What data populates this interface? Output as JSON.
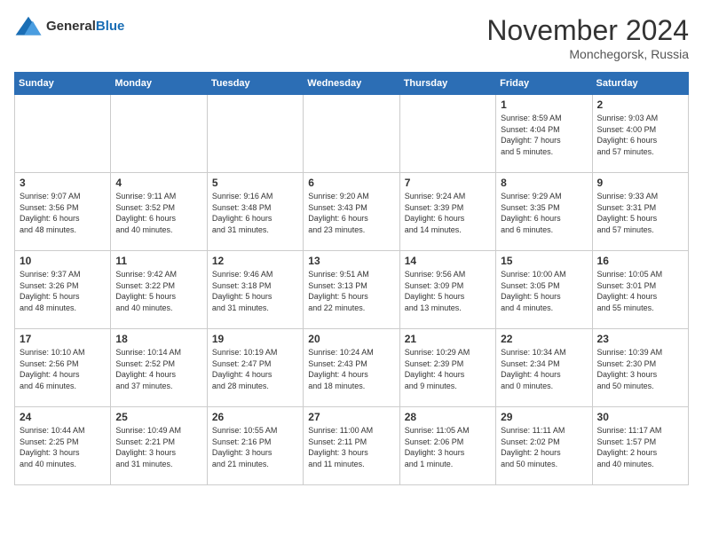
{
  "logo": {
    "general": "General",
    "blue": "Blue"
  },
  "title": "November 2024",
  "location": "Monchegorsk, Russia",
  "days_header": [
    "Sunday",
    "Monday",
    "Tuesday",
    "Wednesday",
    "Thursday",
    "Friday",
    "Saturday"
  ],
  "weeks": [
    [
      {
        "day": "",
        "info": ""
      },
      {
        "day": "",
        "info": ""
      },
      {
        "day": "",
        "info": ""
      },
      {
        "day": "",
        "info": ""
      },
      {
        "day": "",
        "info": ""
      },
      {
        "day": "1",
        "info": "Sunrise: 8:59 AM\nSunset: 4:04 PM\nDaylight: 7 hours\nand 5 minutes."
      },
      {
        "day": "2",
        "info": "Sunrise: 9:03 AM\nSunset: 4:00 PM\nDaylight: 6 hours\nand 57 minutes."
      }
    ],
    [
      {
        "day": "3",
        "info": "Sunrise: 9:07 AM\nSunset: 3:56 PM\nDaylight: 6 hours\nand 48 minutes."
      },
      {
        "day": "4",
        "info": "Sunrise: 9:11 AM\nSunset: 3:52 PM\nDaylight: 6 hours\nand 40 minutes."
      },
      {
        "day": "5",
        "info": "Sunrise: 9:16 AM\nSunset: 3:48 PM\nDaylight: 6 hours\nand 31 minutes."
      },
      {
        "day": "6",
        "info": "Sunrise: 9:20 AM\nSunset: 3:43 PM\nDaylight: 6 hours\nand 23 minutes."
      },
      {
        "day": "7",
        "info": "Sunrise: 9:24 AM\nSunset: 3:39 PM\nDaylight: 6 hours\nand 14 minutes."
      },
      {
        "day": "8",
        "info": "Sunrise: 9:29 AM\nSunset: 3:35 PM\nDaylight: 6 hours\nand 6 minutes."
      },
      {
        "day": "9",
        "info": "Sunrise: 9:33 AM\nSunset: 3:31 PM\nDaylight: 5 hours\nand 57 minutes."
      }
    ],
    [
      {
        "day": "10",
        "info": "Sunrise: 9:37 AM\nSunset: 3:26 PM\nDaylight: 5 hours\nand 48 minutes."
      },
      {
        "day": "11",
        "info": "Sunrise: 9:42 AM\nSunset: 3:22 PM\nDaylight: 5 hours\nand 40 minutes."
      },
      {
        "day": "12",
        "info": "Sunrise: 9:46 AM\nSunset: 3:18 PM\nDaylight: 5 hours\nand 31 minutes."
      },
      {
        "day": "13",
        "info": "Sunrise: 9:51 AM\nSunset: 3:13 PM\nDaylight: 5 hours\nand 22 minutes."
      },
      {
        "day": "14",
        "info": "Sunrise: 9:56 AM\nSunset: 3:09 PM\nDaylight: 5 hours\nand 13 minutes."
      },
      {
        "day": "15",
        "info": "Sunrise: 10:00 AM\nSunset: 3:05 PM\nDaylight: 5 hours\nand 4 minutes."
      },
      {
        "day": "16",
        "info": "Sunrise: 10:05 AM\nSunset: 3:01 PM\nDaylight: 4 hours\nand 55 minutes."
      }
    ],
    [
      {
        "day": "17",
        "info": "Sunrise: 10:10 AM\nSunset: 2:56 PM\nDaylight: 4 hours\nand 46 minutes."
      },
      {
        "day": "18",
        "info": "Sunrise: 10:14 AM\nSunset: 2:52 PM\nDaylight: 4 hours\nand 37 minutes."
      },
      {
        "day": "19",
        "info": "Sunrise: 10:19 AM\nSunset: 2:47 PM\nDaylight: 4 hours\nand 28 minutes."
      },
      {
        "day": "20",
        "info": "Sunrise: 10:24 AM\nSunset: 2:43 PM\nDaylight: 4 hours\nand 18 minutes."
      },
      {
        "day": "21",
        "info": "Sunrise: 10:29 AM\nSunset: 2:39 PM\nDaylight: 4 hours\nand 9 minutes."
      },
      {
        "day": "22",
        "info": "Sunrise: 10:34 AM\nSunset: 2:34 PM\nDaylight: 4 hours\nand 0 minutes."
      },
      {
        "day": "23",
        "info": "Sunrise: 10:39 AM\nSunset: 2:30 PM\nDaylight: 3 hours\nand 50 minutes."
      }
    ],
    [
      {
        "day": "24",
        "info": "Sunrise: 10:44 AM\nSunset: 2:25 PM\nDaylight: 3 hours\nand 40 minutes."
      },
      {
        "day": "25",
        "info": "Sunrise: 10:49 AM\nSunset: 2:21 PM\nDaylight: 3 hours\nand 31 minutes."
      },
      {
        "day": "26",
        "info": "Sunrise: 10:55 AM\nSunset: 2:16 PM\nDaylight: 3 hours\nand 21 minutes."
      },
      {
        "day": "27",
        "info": "Sunrise: 11:00 AM\nSunset: 2:11 PM\nDaylight: 3 hours\nand 11 minutes."
      },
      {
        "day": "28",
        "info": "Sunrise: 11:05 AM\nSunset: 2:06 PM\nDaylight: 3 hours\nand 1 minute."
      },
      {
        "day": "29",
        "info": "Sunrise: 11:11 AM\nSunset: 2:02 PM\nDaylight: 2 hours\nand 50 minutes."
      },
      {
        "day": "30",
        "info": "Sunrise: 11:17 AM\nSunset: 1:57 PM\nDaylight: 2 hours\nand 40 minutes."
      }
    ]
  ]
}
